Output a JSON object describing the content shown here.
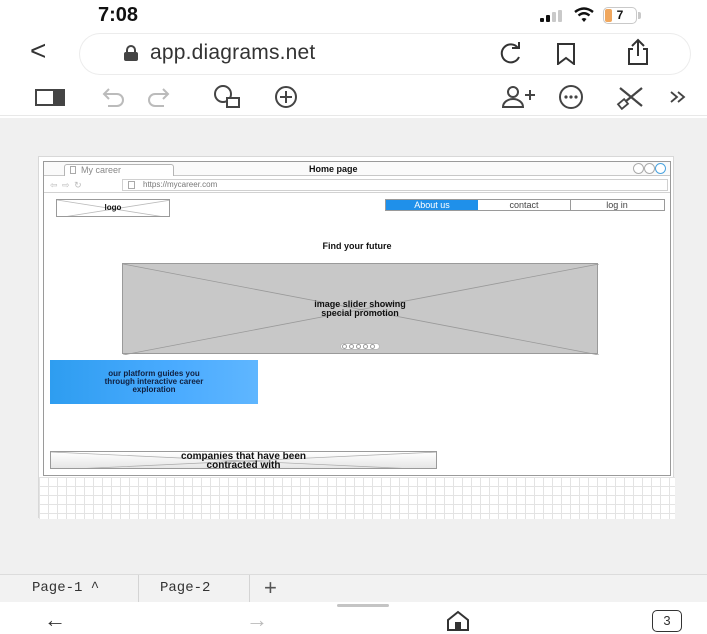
{
  "status": {
    "time": "7:08",
    "battery": "7"
  },
  "browser": {
    "url": "app.diagrams.net",
    "tab_count": "3"
  },
  "mockup": {
    "tab_label": "My career",
    "window_title": "Home page",
    "address": "https://mycareer.com",
    "logo_label": "logo",
    "nav_tabs": [
      {
        "label": "About us",
        "active": true
      },
      {
        "label": "contact",
        "active": false
      },
      {
        "label": "log in",
        "active": false
      }
    ],
    "headline": "Find your future",
    "slider_caption_line1": "image slider showing",
    "slider_caption_line2": "special promotion",
    "promo_line1": "our platform guides you",
    "promo_line2": "through interactive career",
    "promo_line3": "exploration",
    "companies_line1": "companies that have been",
    "companies_line2": "contracted with"
  },
  "pages": {
    "items": [
      {
        "label": "Page-1 ^",
        "active": true
      },
      {
        "label": "Page-2",
        "active": false
      }
    ],
    "add_label": "+"
  },
  "colors": {
    "accent_blue": "#1f90ea",
    "promo_blue": "#4aabff",
    "placeholder_gray": "#c8c8c8",
    "battery_orange": "#f0a75e"
  }
}
